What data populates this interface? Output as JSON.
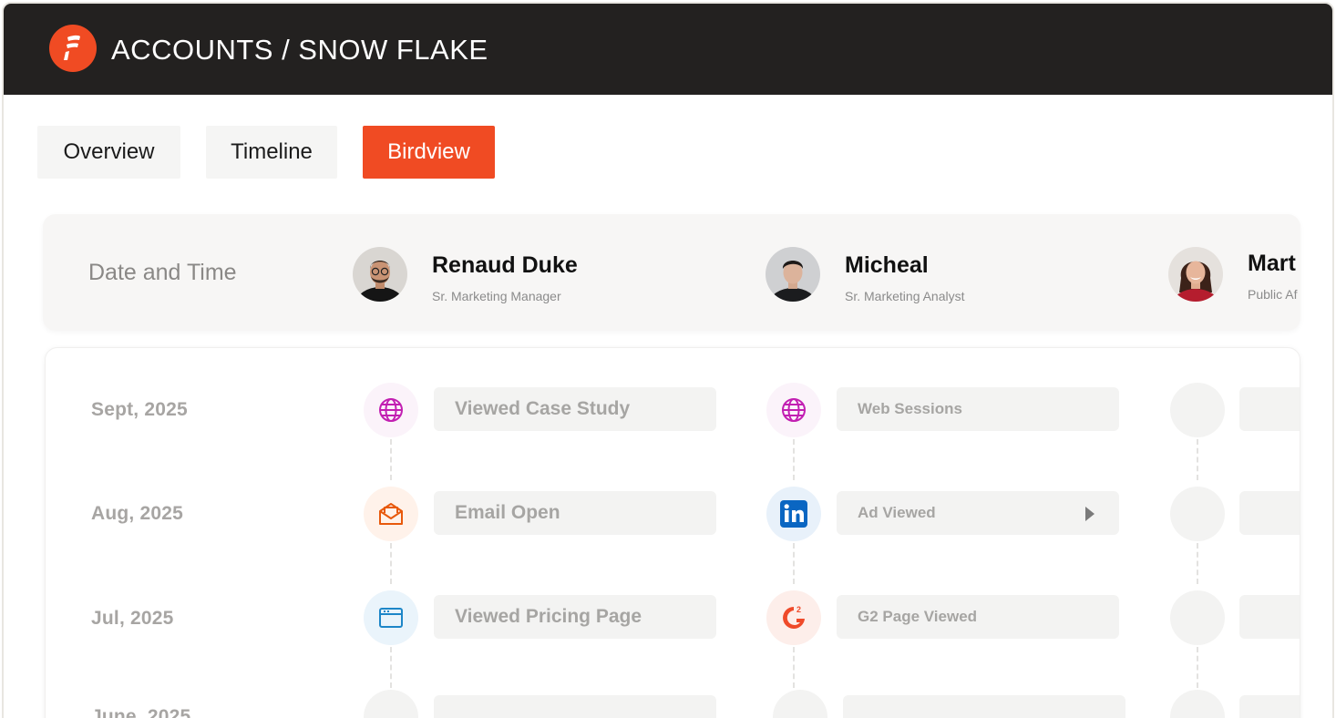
{
  "app": {
    "title": "ACCOUNTS / SNOW FLAKE",
    "brand_color": "#f04b23",
    "logo_icon": "brand-f-icon"
  },
  "tabs": [
    {
      "label": "Overview",
      "active": false
    },
    {
      "label": "Timeline",
      "active": false
    },
    {
      "label": "Birdview",
      "active": true
    }
  ],
  "header": {
    "date_column": "Date and Time",
    "people": [
      {
        "name": "Renaud Duke",
        "role": "Sr. Marketing Manager"
      },
      {
        "name": "Micheal",
        "role": "Sr. Marketing Analyst"
      },
      {
        "name": "Mart",
        "role": "Public Af"
      }
    ]
  },
  "rows": [
    {
      "date": "Sept, 2025",
      "events": [
        {
          "icon": "globe-icon",
          "label": "Viewed Case Study"
        },
        {
          "icon": "globe-icon",
          "label": "Web Sessions"
        }
      ]
    },
    {
      "date": "Aug, 2025",
      "events": [
        {
          "icon": "envelope-icon",
          "label": "Email Open"
        },
        {
          "icon": "linkedin-icon",
          "label": "Ad Viewed"
        }
      ]
    },
    {
      "date": "Jul, 2025",
      "events": [
        {
          "icon": "browser-window-icon",
          "label": "Viewed Pricing Page"
        },
        {
          "icon": "g2-icon",
          "label": "G2 Page Viewed"
        }
      ]
    },
    {
      "date": "June, 2025",
      "events": []
    }
  ],
  "colors": {
    "globe": "#c21fb2",
    "envelope": "#e8590c",
    "linkedin": "#0a66c2",
    "browser": "#1d86c8",
    "g2": "#ef4a2a"
  }
}
